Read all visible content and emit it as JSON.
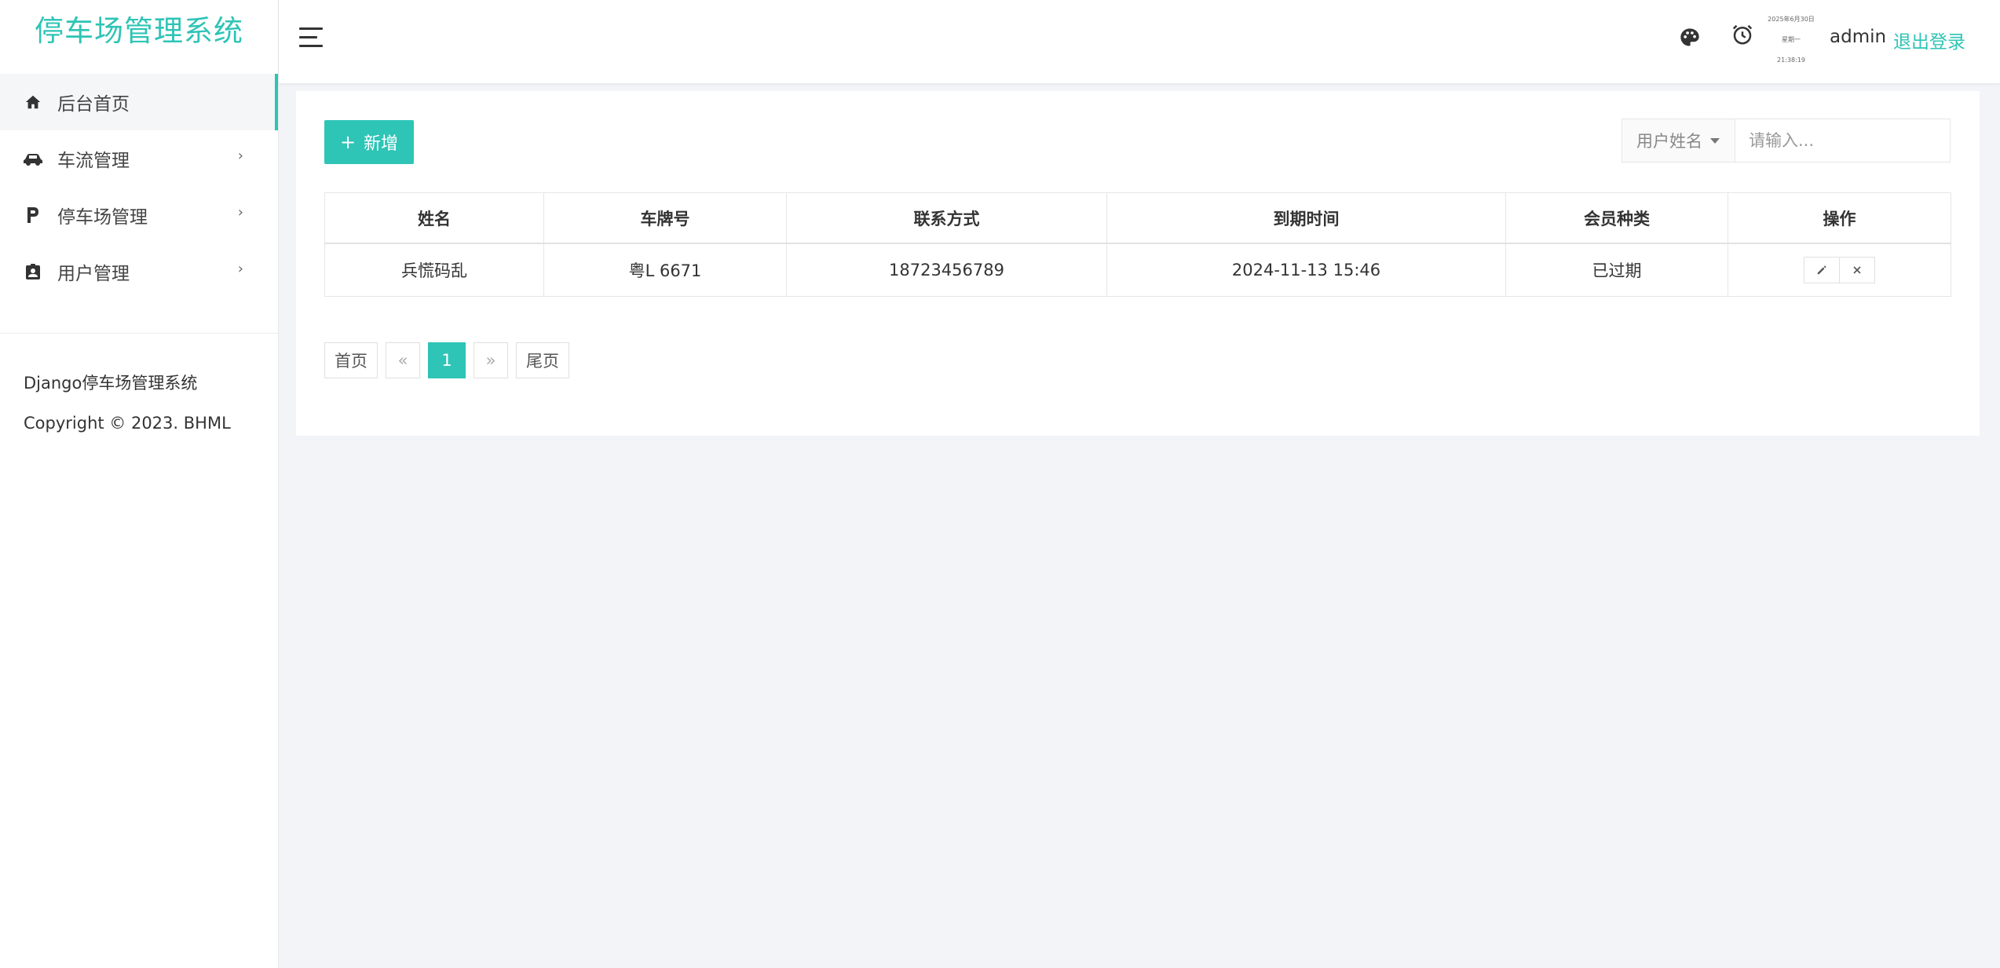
{
  "brand": "停车场管理系统",
  "sidebar": {
    "items": [
      {
        "label": "后台首页",
        "icon": "home-icon",
        "active": true
      },
      {
        "label": "车流管理",
        "icon": "car-icon",
        "chevron": "›"
      },
      {
        "label": "停车场管理",
        "icon": "parking-icon",
        "chevron": "›"
      },
      {
        "label": "用户管理",
        "icon": "user-badge-icon",
        "chevron": "›"
      }
    ],
    "footer": {
      "line1": "Django停车场管理系统",
      "line2": "Copyright © 2023. BHML"
    }
  },
  "header": {
    "icons": [
      "palette-icon",
      "alarm-clock-icon"
    ],
    "clock": {
      "date": "2025年6月30日",
      "weekday": "星期一",
      "time": "21:38:19"
    },
    "username": "admin",
    "logout": "退出登录"
  },
  "toolbar": {
    "add_label": "新增",
    "add_icon": "+",
    "search_field": "用户姓名",
    "search_placeholder": "请输入..."
  },
  "table": {
    "columns": [
      "姓名",
      "车牌号",
      "联系方式",
      "到期时间",
      "会员种类",
      "操作"
    ],
    "rows": [
      {
        "name": "兵慌码乱",
        "plate": "粤L 6671",
        "phone": "18723456789",
        "expire": "2024-11-13 15:46",
        "member_type": "已过期",
        "actions": [
          "edit-icon",
          "delete-icon"
        ]
      }
    ]
  },
  "pagination": {
    "first": "首页",
    "prev": "«",
    "current": "1",
    "next": "»",
    "last": "尾页"
  },
  "colors": {
    "accent": "#2ec4b6",
    "background": "#f3f4f8"
  }
}
